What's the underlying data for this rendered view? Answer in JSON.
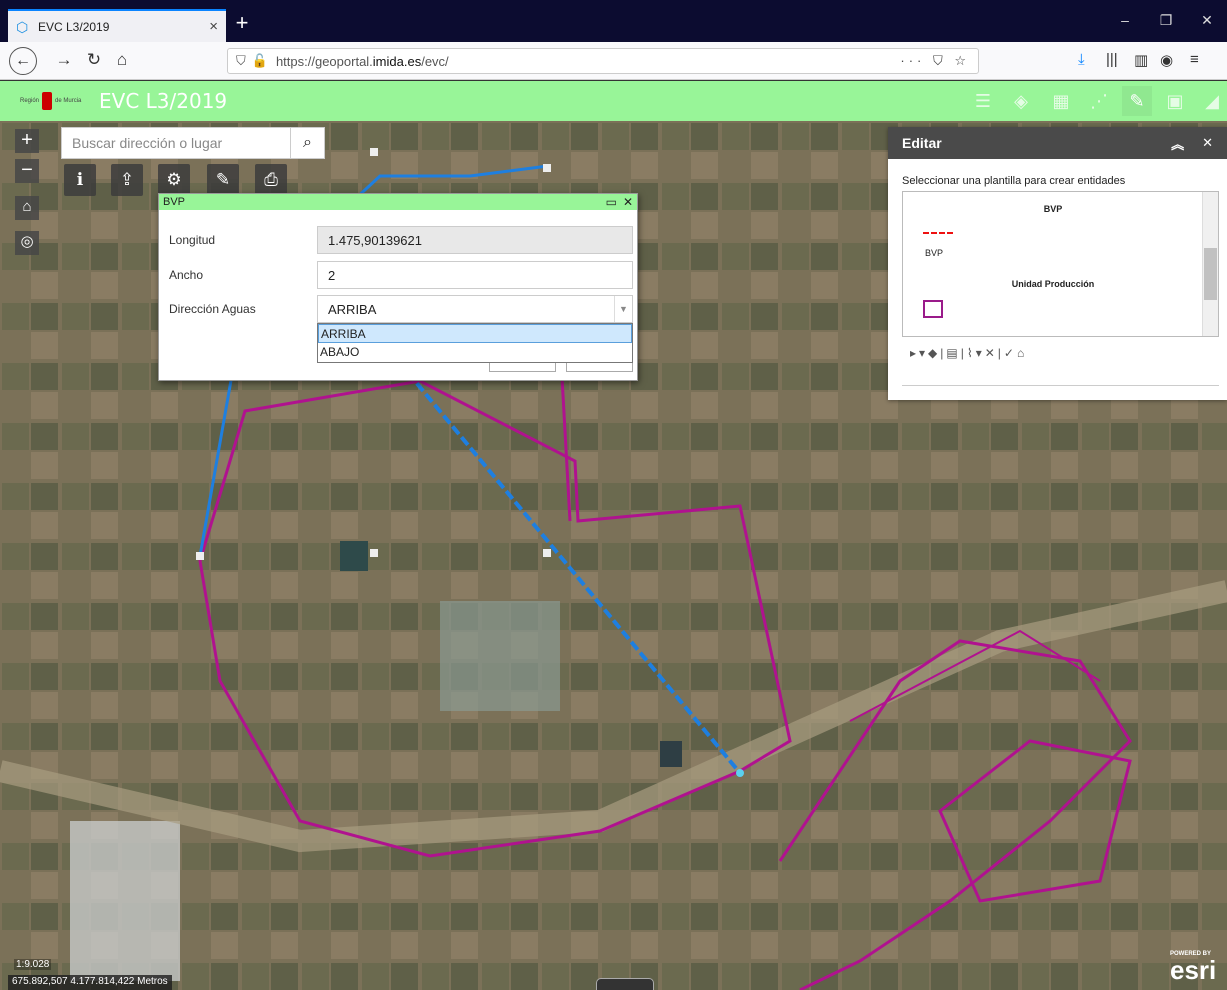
{
  "browser": {
    "tab_title": "EVC L3/2019",
    "tab_close": "×",
    "new_tab": "+",
    "url_prefix": "https://geoportal.",
    "url_domain": "imida.es",
    "url_path": "/evc/",
    "url_right": "··· ⛉ ☆",
    "win_min": "–",
    "win_max": "❐",
    "win_close": "✕"
  },
  "app": {
    "logo_text_left": "Región",
    "logo_text_right": "de Murcia",
    "title": "EVC L3/2019",
    "bar_color": "#98f598"
  },
  "map": {
    "search_placeholder": "Buscar dirección o lugar",
    "zoom_in": "+",
    "zoom_out": "−",
    "scale": "1:9.028",
    "coords": "675.892,507 4.177.814,422 Metros",
    "attribution_small": "POWERED BY",
    "attribution": "esri"
  },
  "dialog": {
    "title": "BVP",
    "fields": [
      {
        "label": "Longitud",
        "value": "1.475,90139621"
      },
      {
        "label": "Ancho",
        "value": "2"
      },
      {
        "label": "Dirección Aguas",
        "value": "ARRIBA"
      }
    ],
    "dropdown_options": [
      "ARRIBA",
      "ABAJO"
    ]
  },
  "edit_panel": {
    "title": "Editar",
    "subtitle": "Seleccionar una plantilla para crear entidades",
    "templates": [
      {
        "group": "BVP",
        "item": "BVP"
      },
      {
        "group": "Unidad Producción"
      }
    ]
  },
  "colors": {
    "line_blue": "#1e7fe0",
    "parcel_magenta": "#b0128f",
    "accent": "#98f598"
  }
}
